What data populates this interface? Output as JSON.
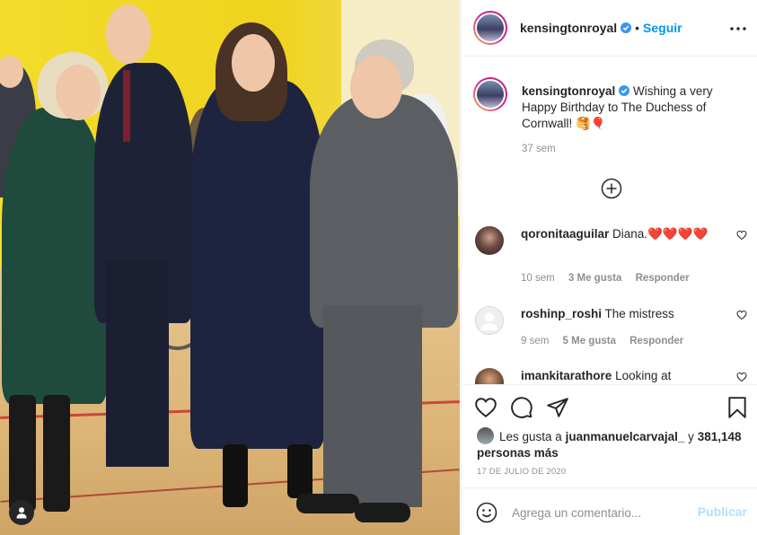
{
  "post": {
    "username": "kensingtonroyal",
    "follow_label": "Seguir",
    "separator": "•",
    "caption_text": "Wishing a very Happy Birthday to The Duchess of Cornwall! 🥞🎈",
    "caption_time": "37 sem",
    "more_icon": "more-horizontal-icon"
  },
  "comments": [
    {
      "username": "qoronitaaguilar",
      "text": "Diana.❤️❤️❤️❤️",
      "time": "10 sem",
      "likes": "3 Me gusta",
      "reply": "Responder"
    },
    {
      "username": "roshinp_roshi",
      "text": "The mistress",
      "time": "9 sem",
      "likes": "5 Me gusta",
      "reply": "Responder"
    },
    {
      "username": "imankitarathore",
      "text": "Looking at",
      "time": "",
      "likes": "",
      "reply": ""
    }
  ],
  "actions": {
    "liked_by_prefix": "Les gusta a",
    "liked_by_user": "juanmanuelcarvajal_",
    "liked_by_and": "y",
    "others_count": "381,148 personas más",
    "date": "17 DE JULIO DE 2020"
  },
  "composer": {
    "placeholder": "Agrega un comentario...",
    "post_label": "Publicar"
  },
  "colors": {
    "accent": "#0095f6",
    "publish_disabled": "#b2dffc",
    "muted": "#8e8e8e",
    "verified": "#3897f0"
  }
}
